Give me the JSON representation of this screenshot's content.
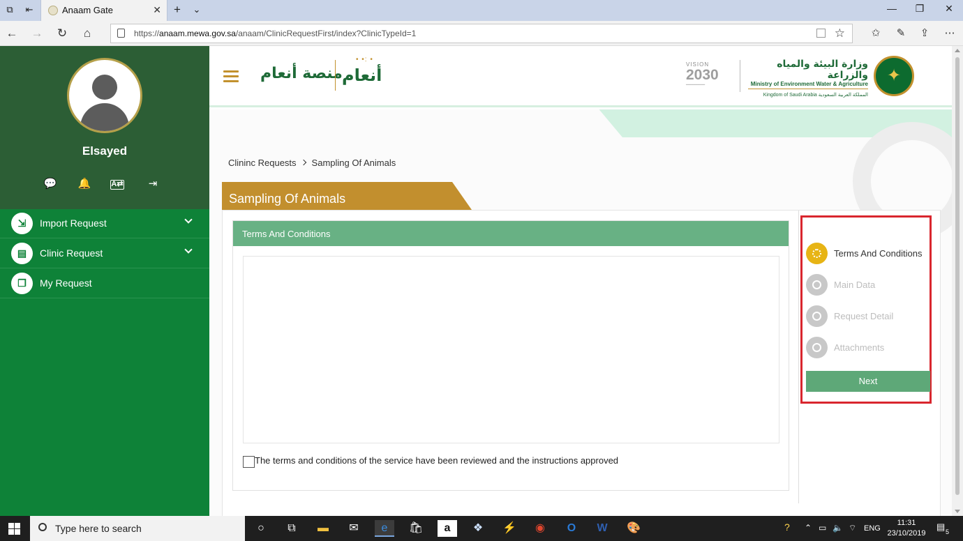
{
  "browser": {
    "tab_title": "Anaam Gate",
    "url_prefix": "https://",
    "url_host": "anaam.mewa.gov.sa",
    "url_path": "/anaam/ClinicRequestFirst/index?ClinicTypeId=1"
  },
  "sidebar": {
    "username": "Elsayed",
    "items": [
      {
        "label": "Import Request"
      },
      {
        "label": "Clinic Request"
      },
      {
        "label": "My Request"
      }
    ]
  },
  "header": {
    "platform_name_ar": "منصة أنعام",
    "logo_mark_ar": "أنعام",
    "vision_label": "VISION",
    "vision_year": "2030",
    "ministry_ar": "وزارة البيئة والمياه والزراعة",
    "ministry_en": "Ministry of Environment Water & Agriculture",
    "kingdom": "Kingdom of Saudi Arabia  المملكة العربية السعودية"
  },
  "breadcrumb": {
    "parent": "Clininc Requests",
    "current": "Sampling Of Animals"
  },
  "page_title": "Sampling Of Animals",
  "terms": {
    "header": "Terms And Conditions",
    "checkbox_label": "The terms and conditions of the service have been reviewed and the instructions approved",
    "checked": false
  },
  "steps": [
    {
      "label": "Terms And Conditions",
      "active": true
    },
    {
      "label": "Main Data",
      "active": false
    },
    {
      "label": "Request Detail",
      "active": false
    },
    {
      "label": "Attachments",
      "active": false
    }
  ],
  "next_label": "Next",
  "taskbar": {
    "search_placeholder": "Type here to search",
    "lang": "ENG",
    "time": "11:31",
    "date": "23/10/2019",
    "notifications": "5"
  },
  "colors": {
    "sidebar_green": "#0e8238",
    "profile_green": "#2c5e35",
    "gold": "#c28f2e",
    "panel_header": "#68b184",
    "active_step": "#e7b415",
    "highlight_border": "#d9262e"
  }
}
